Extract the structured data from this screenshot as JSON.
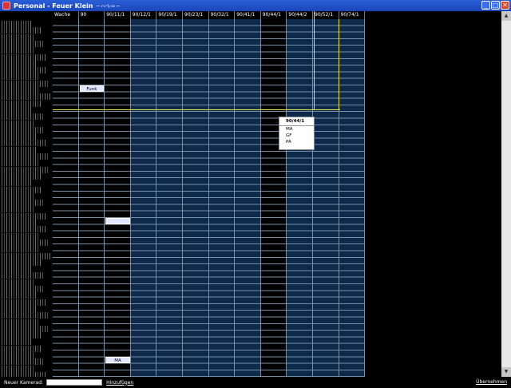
{
  "window": {
    "title": "Personal - Feuer Klein",
    "controls": [
      "minimize",
      "maximize",
      "close"
    ]
  },
  "table": {
    "headers": [
      "Wache",
      "90",
      "90/11/1",
      "90/12/1",
      "90/19/1",
      "90/23/1",
      "90/32/1",
      "90/41/1",
      "90/44/1",
      "90/44/2",
      "90/52/1",
      "90/74/1"
    ],
    "column_styles": [
      "dark",
      "dark",
      "dark",
      "blue",
      "blue",
      "blue",
      "blue",
      "blue",
      "dark",
      "blue",
      "blue",
      "blue"
    ],
    "assignments": [
      {
        "column": 1,
        "row": 10,
        "text": "Funk"
      },
      {
        "column": 2,
        "row": 30,
        "text": ""
      },
      {
        "column": 2,
        "row": 51,
        "text": "MA"
      }
    ],
    "highlighted_column": 8,
    "highlighted_row": 14
  },
  "context_menu": {
    "title": "90/44/1",
    "items": [
      "MA",
      "GF",
      "PA"
    ]
  },
  "footer": {
    "new_member_label": "Neuer Kamerad:",
    "new_member_value": "",
    "add_label": "Hinzufügen",
    "apply_label": "Übernehmen"
  },
  "colors": {
    "title_bar": "#1b45b8",
    "grid_blue": "#0d2a4a",
    "highlight": "#e8e84a"
  }
}
